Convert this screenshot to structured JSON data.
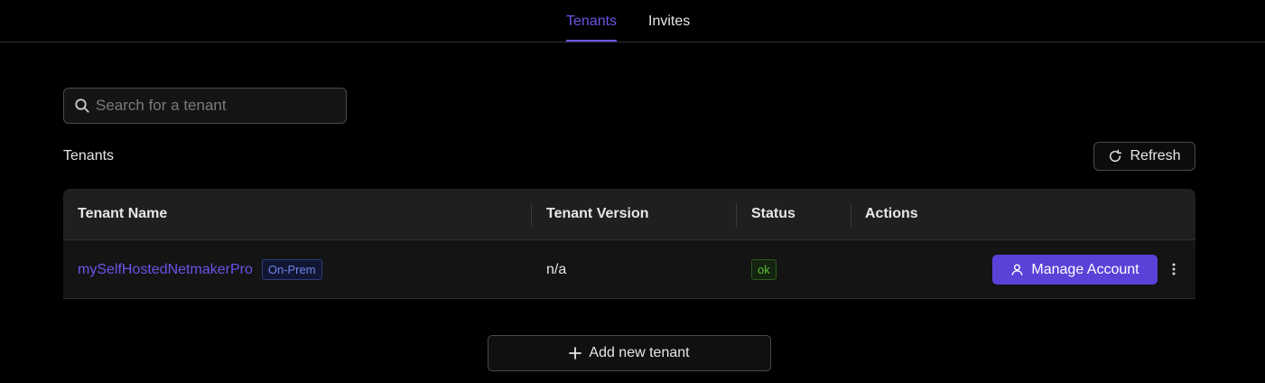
{
  "tabs": [
    {
      "label": "Tenants",
      "active": true
    },
    {
      "label": "Invites",
      "active": false
    }
  ],
  "search": {
    "placeholder": "Search for a tenant",
    "value": ""
  },
  "section": {
    "title": "Tenants",
    "refresh_label": "Refresh"
  },
  "table": {
    "columns": [
      "Tenant Name",
      "Tenant Version",
      "Status",
      "Actions"
    ],
    "rows": [
      {
        "tenant_name": "mySelfHostedNetmakerPro",
        "tenant_badge": "On-Prem",
        "tenant_version": "n/a",
        "status": "ok",
        "action_label": "Manage Account"
      }
    ]
  },
  "add_button": {
    "label": "Add new tenant"
  },
  "icons": {
    "search": "search-icon",
    "refresh": "refresh-icon",
    "user": "user-icon",
    "more": "more-vertical-icon",
    "plus": "plus-icon"
  },
  "colors": {
    "accent": "#6a55e8",
    "primary_button": "#5a41d8",
    "status_ok": "#5bbf3a",
    "background": "#000000"
  }
}
